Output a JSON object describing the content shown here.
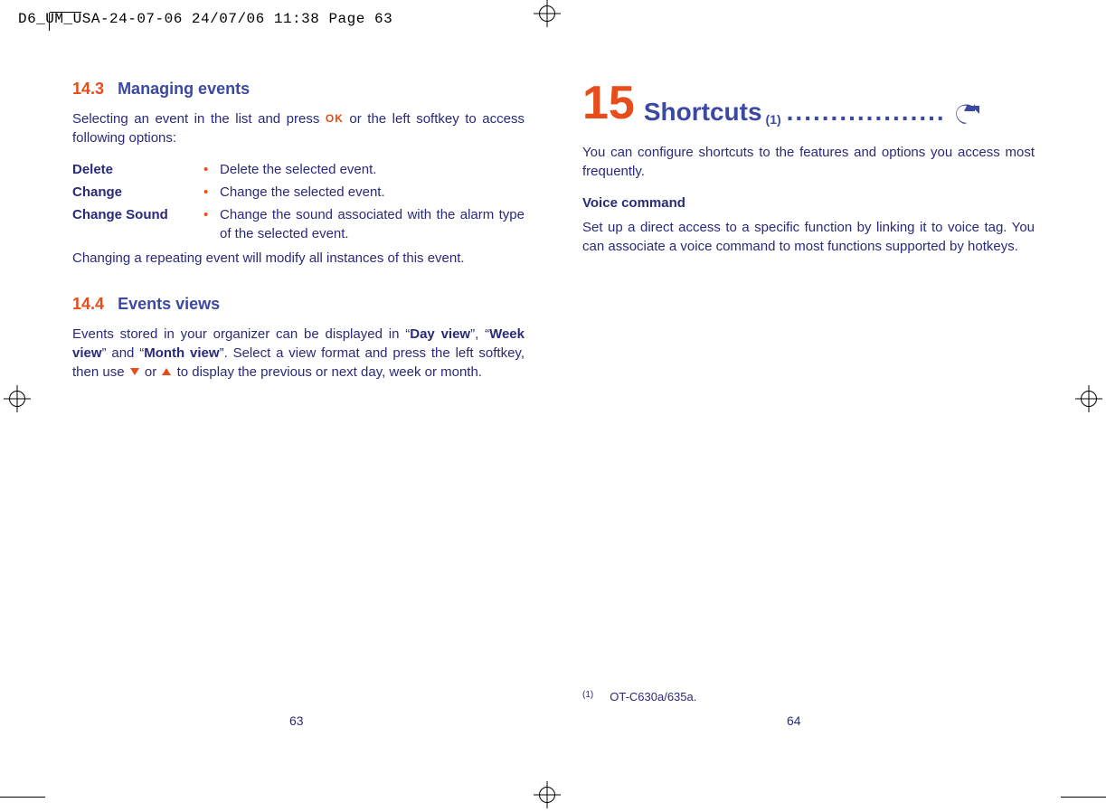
{
  "print_header": "D6_UM_USA-24-07-06  24/07/06  11:38  Page 63",
  "left": {
    "sec1_num": "14.3",
    "sec1_title": "Managing events",
    "intro_a": "Selecting an event in the list and press ",
    "intro_b": " or the left softkey to access following options:",
    "options": [
      {
        "label": "Delete",
        "desc": "Delete the selected event."
      },
      {
        "label": "Change",
        "desc": "Change the selected event."
      },
      {
        "label": "Change Sound",
        "desc": "Change the sound associated with the alarm type of the selected event."
      }
    ],
    "note": "Changing a repeating event will modify all instances of this event.",
    "sec2_num": "14.4",
    "sec2_title": "Events views",
    "views_a": "Events stored in your organizer can be displayed in “",
    "views_b": "Day view",
    "views_c": "”, “",
    "views_d": "Week view",
    "views_e": "” and “",
    "views_f": "Month view",
    "views_g": "”. Select a view format and press the left softkey, then use ",
    "views_h": " or ",
    "views_i": " to display the previous or next day, week or month.",
    "page_num": "63"
  },
  "right": {
    "chapter_num": "15",
    "chapter_title": "Shortcuts ",
    "chapter_sup": "(1)",
    "chapter_dots": "..................",
    "p1": "You can configure shortcuts to the features and options you access most frequently.",
    "sub1": "Voice command",
    "p2": "Set up a direct access to a specific function by linking it to voice tag. You can associate a voice command to most functions supported by hotkeys.",
    "footnote_sup": "(1)",
    "footnote_text": "OT-C630a/635a.",
    "page_num": "64"
  },
  "icons": {
    "ok": "OK"
  }
}
